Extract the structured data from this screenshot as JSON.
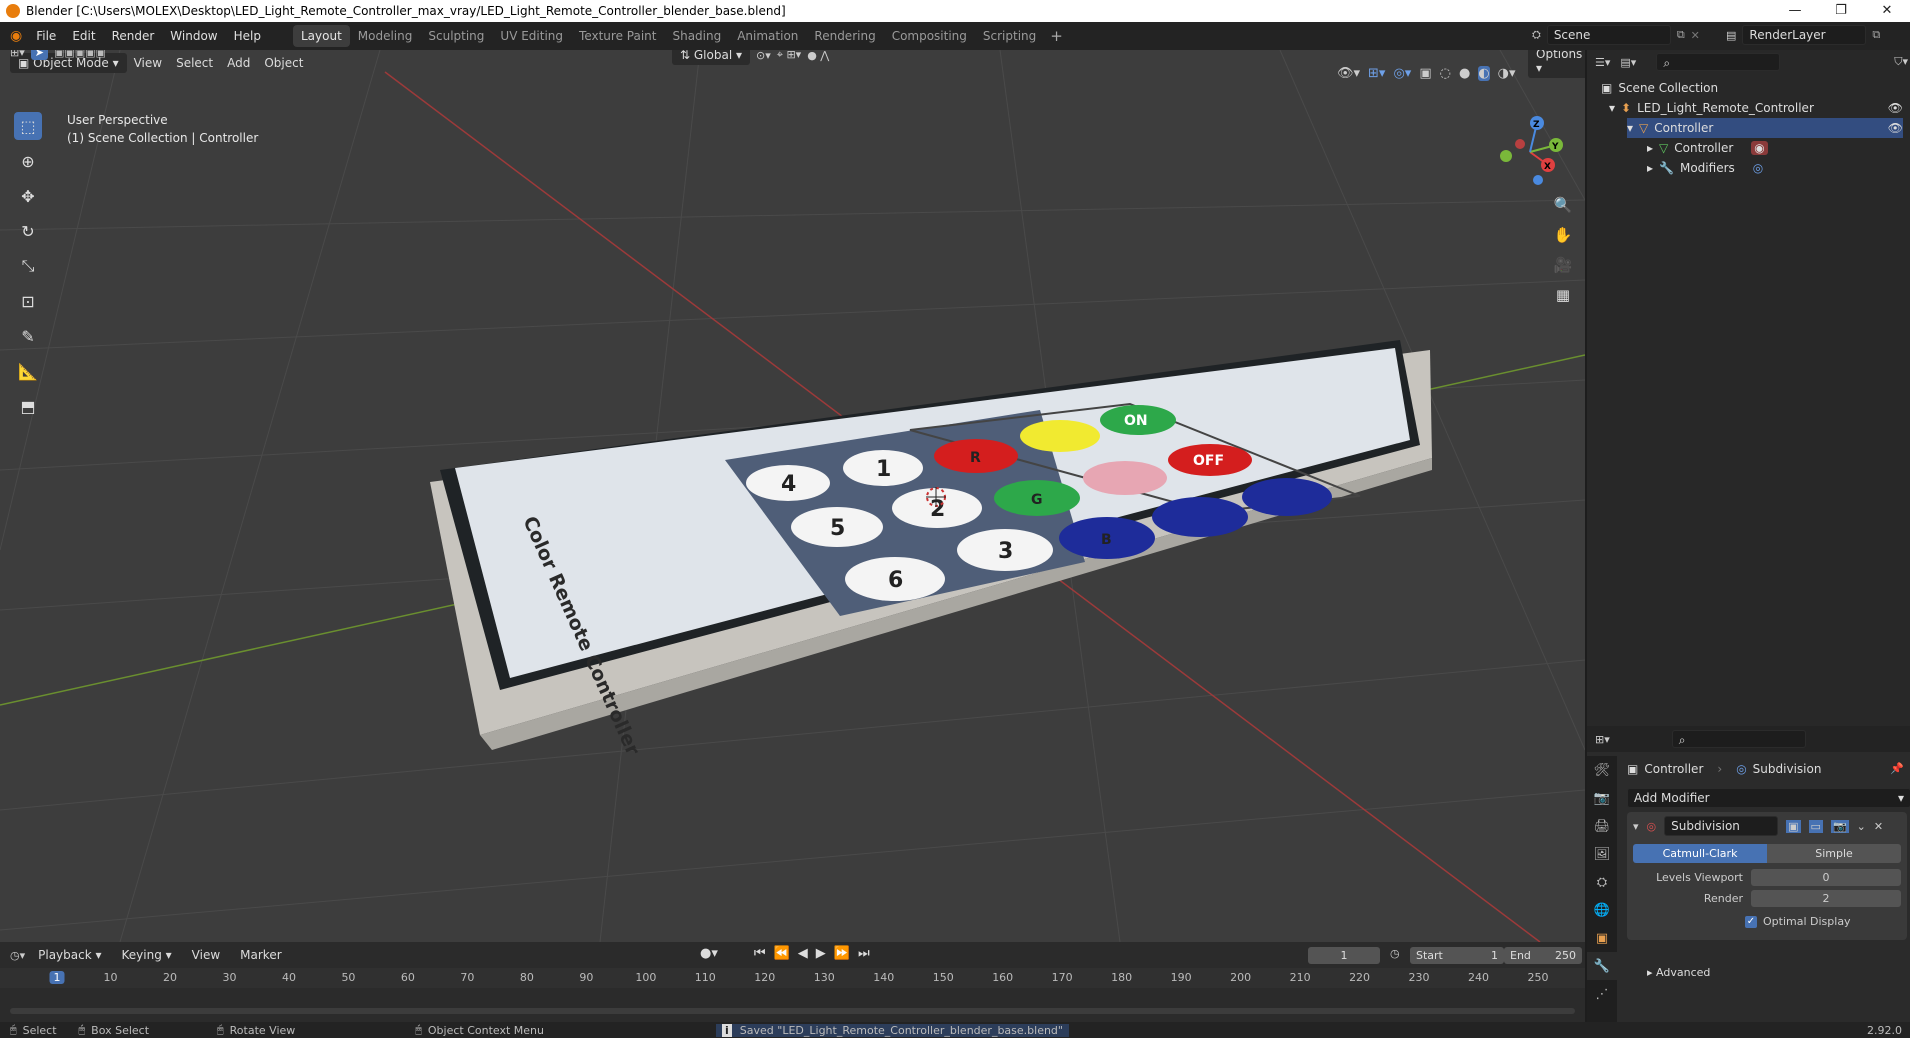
{
  "window": {
    "title": "Blender [C:\\Users\\MOLEX\\Desktop\\LED_Light_Remote_Controller_max_vray/LED_Light_Remote_Controller_blender_base.blend]",
    "minimize": "—",
    "maximize": "❐",
    "close": "✕"
  },
  "menu": [
    "File",
    "Edit",
    "Render",
    "Window",
    "Help"
  ],
  "workspaces": [
    "Layout",
    "Modeling",
    "Sculpting",
    "UV Editing",
    "Texture Paint",
    "Shading",
    "Animation",
    "Rendering",
    "Compositing",
    "Scripting"
  ],
  "scene": {
    "name": "Scene",
    "render_layer": "RenderLayer"
  },
  "viewport": {
    "mode": "Object Mode",
    "menus": [
      "View",
      "Select",
      "Add",
      "Object"
    ],
    "orientation": "Global",
    "options": "Options",
    "overlay_line1": "User Perspective",
    "overlay_line2": "(1) Scene Collection | Controller",
    "gizmo": {
      "x": "X",
      "y": "Y",
      "z": "Z"
    }
  },
  "remote": {
    "label": "Color Remote Controller",
    "numbers": [
      "1",
      "2",
      "3",
      "4",
      "5",
      "6"
    ],
    "buttons": {
      "on": "ON",
      "off": "OFF",
      "r": "R",
      "g": "G",
      "b": "B"
    }
  },
  "outliner": {
    "root": "Scene Collection",
    "collection": "LED_Light_Remote_Controller",
    "object": "Controller",
    "mesh": "Controller",
    "modifiers": "Modifiers"
  },
  "properties": {
    "breadcrumb_object": "Controller",
    "breadcrumb_modifier": "Subdivision",
    "add_modifier": "Add Modifier",
    "modifier_name": "Subdivision",
    "algo_catmull": "Catmull-Clark",
    "algo_simple": "Simple",
    "levels_label": "Levels Viewport",
    "levels_value": "0",
    "render_label": "Render",
    "render_value": "2",
    "optimal_display": "Optimal Display",
    "advanced": "Advanced"
  },
  "timeline": {
    "menus": [
      "Playback",
      "Keying",
      "View",
      "Marker"
    ],
    "current_frame": "1",
    "start_label": "Start",
    "start": "1",
    "end_label": "End",
    "end": "250",
    "ticks": [
      "1",
      "10",
      "20",
      "30",
      "40",
      "50",
      "60",
      "70",
      "80",
      "90",
      "100",
      "110",
      "120",
      "130",
      "140",
      "150",
      "160",
      "170",
      "180",
      "190",
      "200",
      "210",
      "220",
      "230",
      "240",
      "250"
    ]
  },
  "status": {
    "select": "Select",
    "box_select": "Box Select",
    "rotate_view": "Rotate View",
    "context_menu": "Object Context Menu",
    "message": "Saved \"LED_Light_Remote_Controller_blender_base.blend\"",
    "version": "2.92.0"
  }
}
